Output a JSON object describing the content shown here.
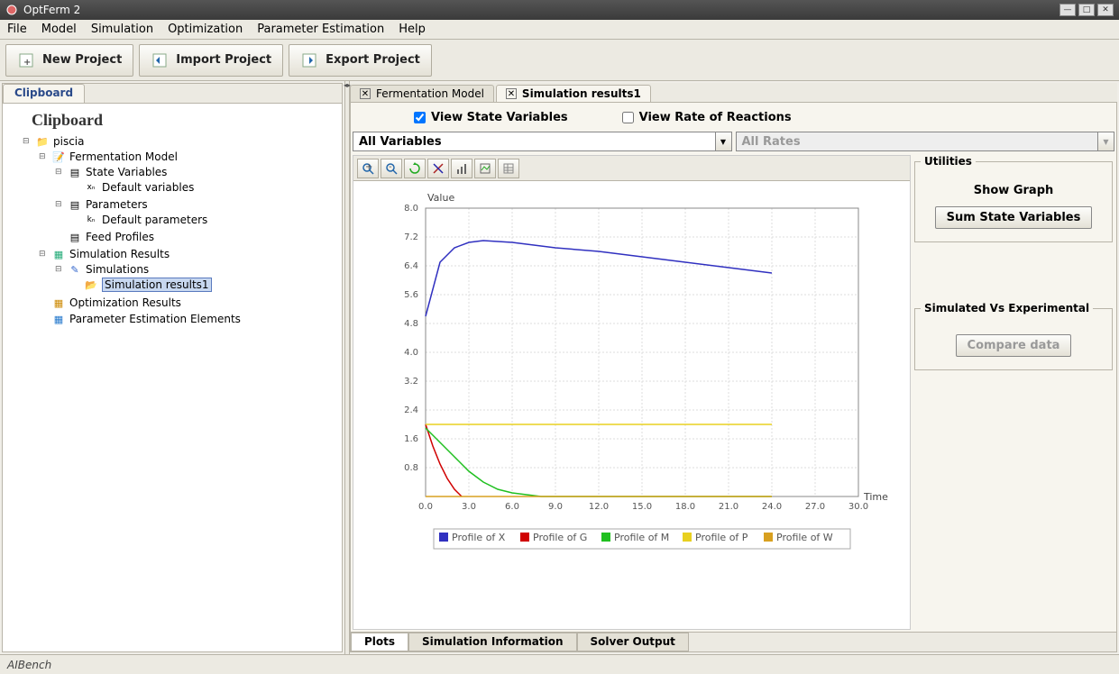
{
  "window": {
    "title": "OptFerm 2"
  },
  "menubar": [
    "File",
    "Model",
    "Simulation",
    "Optimization",
    "Parameter Estimation",
    "Help"
  ],
  "toolbar": [
    {
      "label": "New Project"
    },
    {
      "label": "Import Project"
    },
    {
      "label": "Export Project"
    }
  ],
  "clipboard": {
    "tab_label": "Clipboard",
    "heading": "Clipboard",
    "tree": {
      "root": "piscia",
      "model": "Fermentation Model",
      "state_vars": "State Variables",
      "default_vars": "Default variables",
      "parameters": "Parameters",
      "default_params": "Default parameters",
      "feed": "Feed Profiles",
      "sim_results": "Simulation Results",
      "simulations": "Simulations",
      "sim_results1": "Simulation results1",
      "opt_results": "Optimization Results",
      "par_est": "Parameter Estimation Elements"
    }
  },
  "tabs": [
    {
      "label": "Fermentation Model"
    },
    {
      "label": "Simulation results1"
    }
  ],
  "checks": {
    "state_vars": "View State Variables",
    "rate": "View Rate of Reactions"
  },
  "combos": {
    "vars": "All Variables",
    "rates": "All Rates"
  },
  "util": {
    "heading": "Utilities",
    "show_graph": "Show Graph",
    "sum_state": "Sum State Variables",
    "sim_vs_exp": "Simulated Vs Experimental",
    "compare": "Compare data"
  },
  "bottom_tabs": [
    "Plots",
    "Simulation Information",
    "Solver Output"
  ],
  "statusbar": "AIBench",
  "chart_data": {
    "type": "line",
    "title": "",
    "xlabel": "Time",
    "ylabel": "Value",
    "xlim": [
      0,
      30
    ],
    "ylim": [
      0,
      8
    ],
    "xticks": [
      0.0,
      3.0,
      6.0,
      9.0,
      12.0,
      15.0,
      18.0,
      21.0,
      24.0,
      27.0,
      30.0
    ],
    "yticks": [
      0.8,
      1.6,
      2.4,
      3.2,
      4.0,
      4.8,
      5.6,
      6.4,
      7.2,
      8.0
    ],
    "series": [
      {
        "name": "Profile of X",
        "color": "#3030c0",
        "x": [
          0,
          1,
          2,
          3,
          4,
          6,
          9,
          12,
          15,
          18,
          21,
          24
        ],
        "y": [
          5.0,
          6.5,
          6.9,
          7.05,
          7.1,
          7.05,
          6.9,
          6.8,
          6.65,
          6.5,
          6.35,
          6.2
        ]
      },
      {
        "name": "Profile of G",
        "color": "#d00000",
        "x": [
          0,
          0.5,
          1,
          1.5,
          2,
          2.5
        ],
        "y": [
          2.0,
          1.4,
          0.9,
          0.5,
          0.2,
          0.0
        ]
      },
      {
        "name": "Profile of M",
        "color": "#20c020",
        "x": [
          0,
          1,
          2,
          3,
          4,
          5,
          6,
          7,
          8,
          24
        ],
        "y": [
          1.9,
          1.5,
          1.1,
          0.7,
          0.4,
          0.2,
          0.1,
          0.05,
          0.0,
          0.0
        ]
      },
      {
        "name": "Profile of P",
        "color": "#e8d020",
        "x": [
          0,
          24
        ],
        "y": [
          2.0,
          2.0
        ]
      },
      {
        "name": "Profile of W",
        "color": "#d8a020",
        "x": [
          0,
          24
        ],
        "y": [
          0.0,
          0.0
        ]
      }
    ]
  }
}
